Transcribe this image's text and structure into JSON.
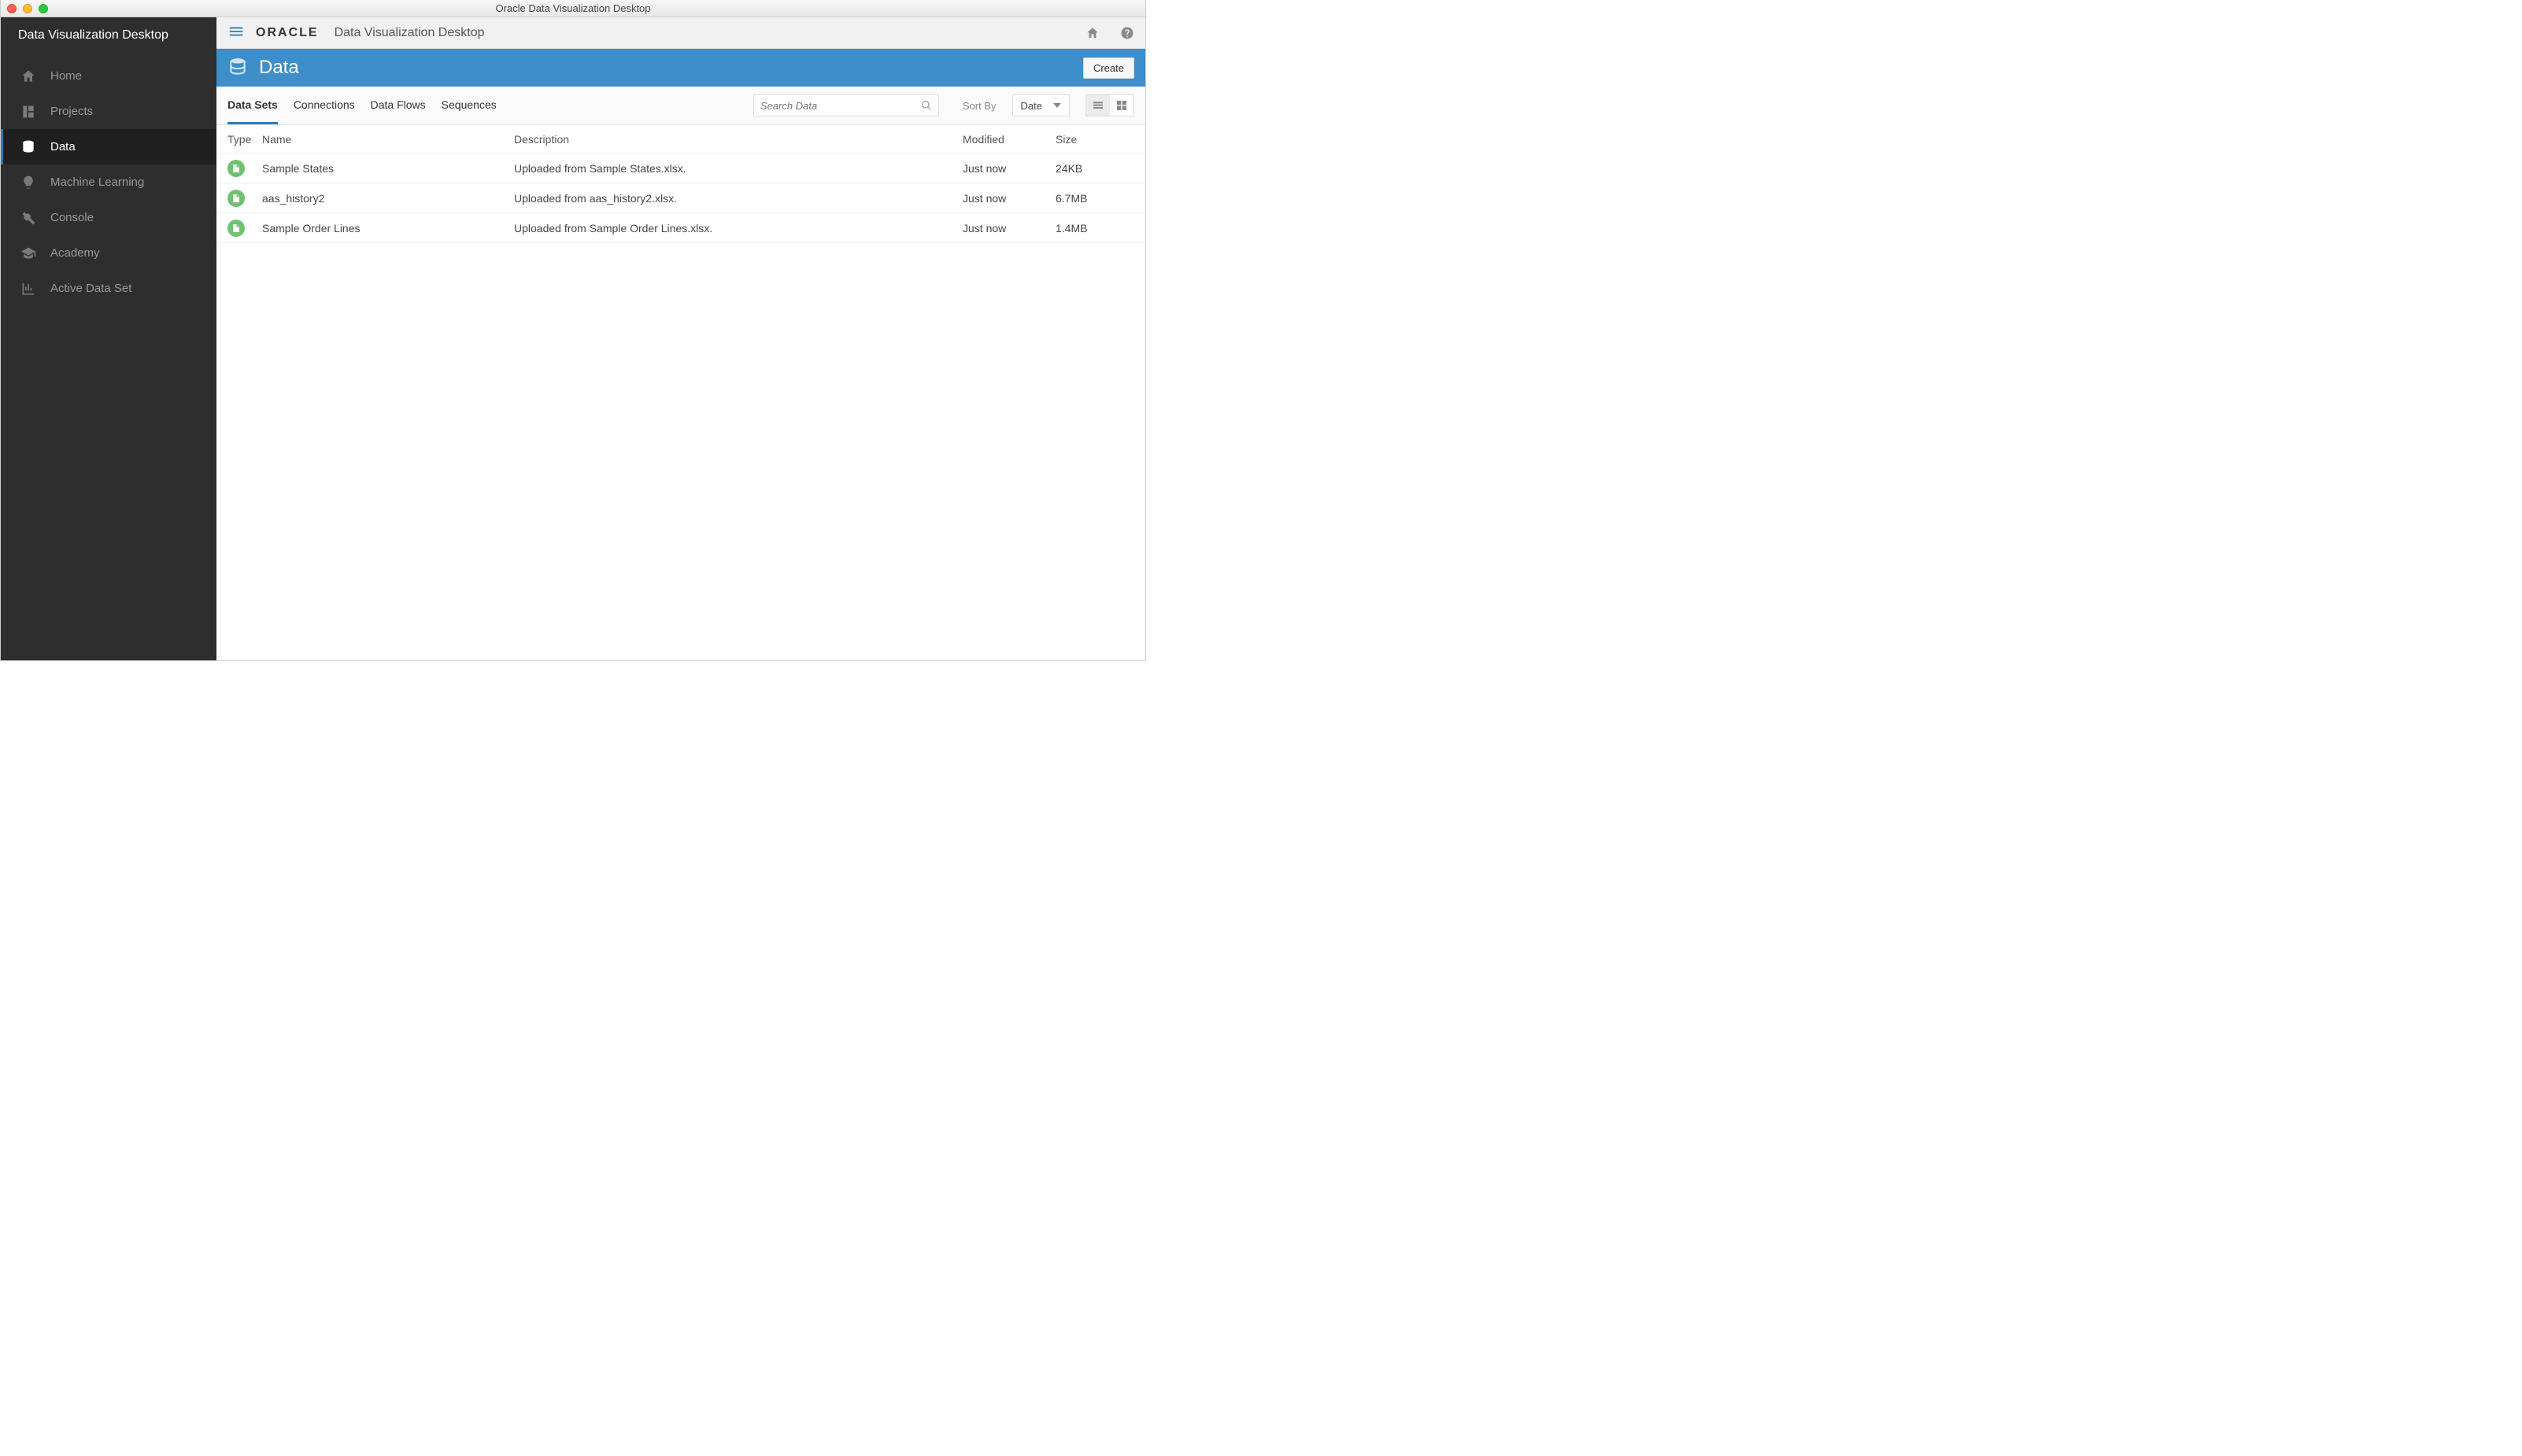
{
  "window": {
    "title": "Oracle Data Visualization Desktop"
  },
  "sidebar": {
    "title": "Data Visualization Desktop",
    "items": [
      {
        "id": "home",
        "label": "Home",
        "icon": "home-icon"
      },
      {
        "id": "projects",
        "label": "Projects",
        "icon": "projects-icon"
      },
      {
        "id": "data",
        "label": "Data",
        "icon": "database-icon",
        "active": true
      },
      {
        "id": "ml",
        "label": "Machine Learning",
        "icon": "bulb-icon"
      },
      {
        "id": "console",
        "label": "Console",
        "icon": "tools-icon"
      },
      {
        "id": "academy",
        "label": "Academy",
        "icon": "academy-icon"
      },
      {
        "id": "active-data-set",
        "label": "Active Data Set",
        "icon": "chart-icon"
      }
    ]
  },
  "topbar": {
    "brand": "ORACLE",
    "product": "Data Visualization Desktop"
  },
  "page": {
    "title": "Data",
    "create_label": "Create"
  },
  "tabs": [
    {
      "id": "data-sets",
      "label": "Data Sets",
      "active": true
    },
    {
      "id": "connections",
      "label": "Connections"
    },
    {
      "id": "data-flows",
      "label": "Data Flows"
    },
    {
      "id": "sequences",
      "label": "Sequences"
    }
  ],
  "search": {
    "placeholder": "Search Data"
  },
  "sort": {
    "label": "Sort By",
    "value": "Date"
  },
  "view": {
    "mode": "list"
  },
  "columns": {
    "type": "Type",
    "name": "Name",
    "description": "Description",
    "modified": "Modified",
    "size": "Size"
  },
  "rows": [
    {
      "type": "xlsx",
      "name": "Sample States",
      "description": "Uploaded from Sample States.xlsx.",
      "modified": "Just now",
      "size": "24KB"
    },
    {
      "type": "xlsx",
      "name": "aas_history2",
      "description": "Uploaded from aas_history2.xlsx.",
      "modified": "Just now",
      "size": "6.7MB"
    },
    {
      "type": "xlsx",
      "name": "Sample Order Lines",
      "description": "Uploaded from Sample Order Lines.xlsx.",
      "modified": "Just now",
      "size": "1.4MB"
    }
  ]
}
